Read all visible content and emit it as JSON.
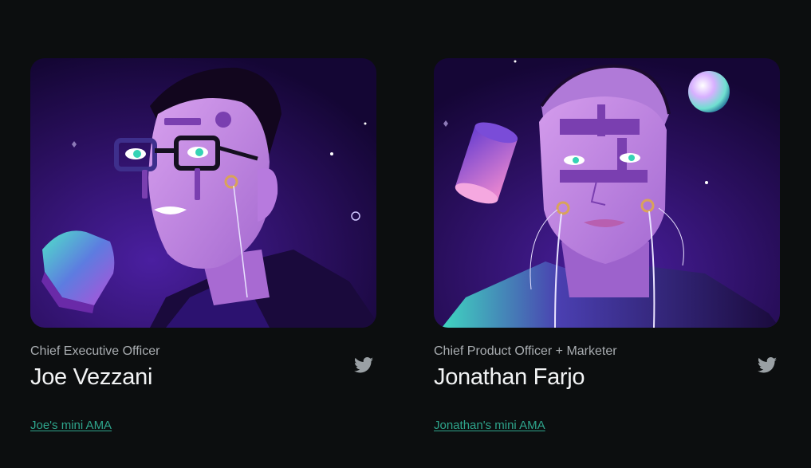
{
  "team": [
    {
      "role": "Chief Executive Officer",
      "name": "Joe Vezzani",
      "ama_link": "Joe's mini AMA",
      "social_icon": "twitter-icon"
    },
    {
      "role": "Chief Product Officer + Marketer",
      "name": "Jonathan Farjo",
      "ama_link": "Jonathan's mini AMA",
      "social_icon": "twitter-icon"
    }
  ],
  "colors": {
    "background": "#0c0e0f",
    "link": "#2ea58c",
    "icon": "#9aa0a4",
    "portrait_bg": "#2a0f5e",
    "skin": "#c98be0"
  }
}
